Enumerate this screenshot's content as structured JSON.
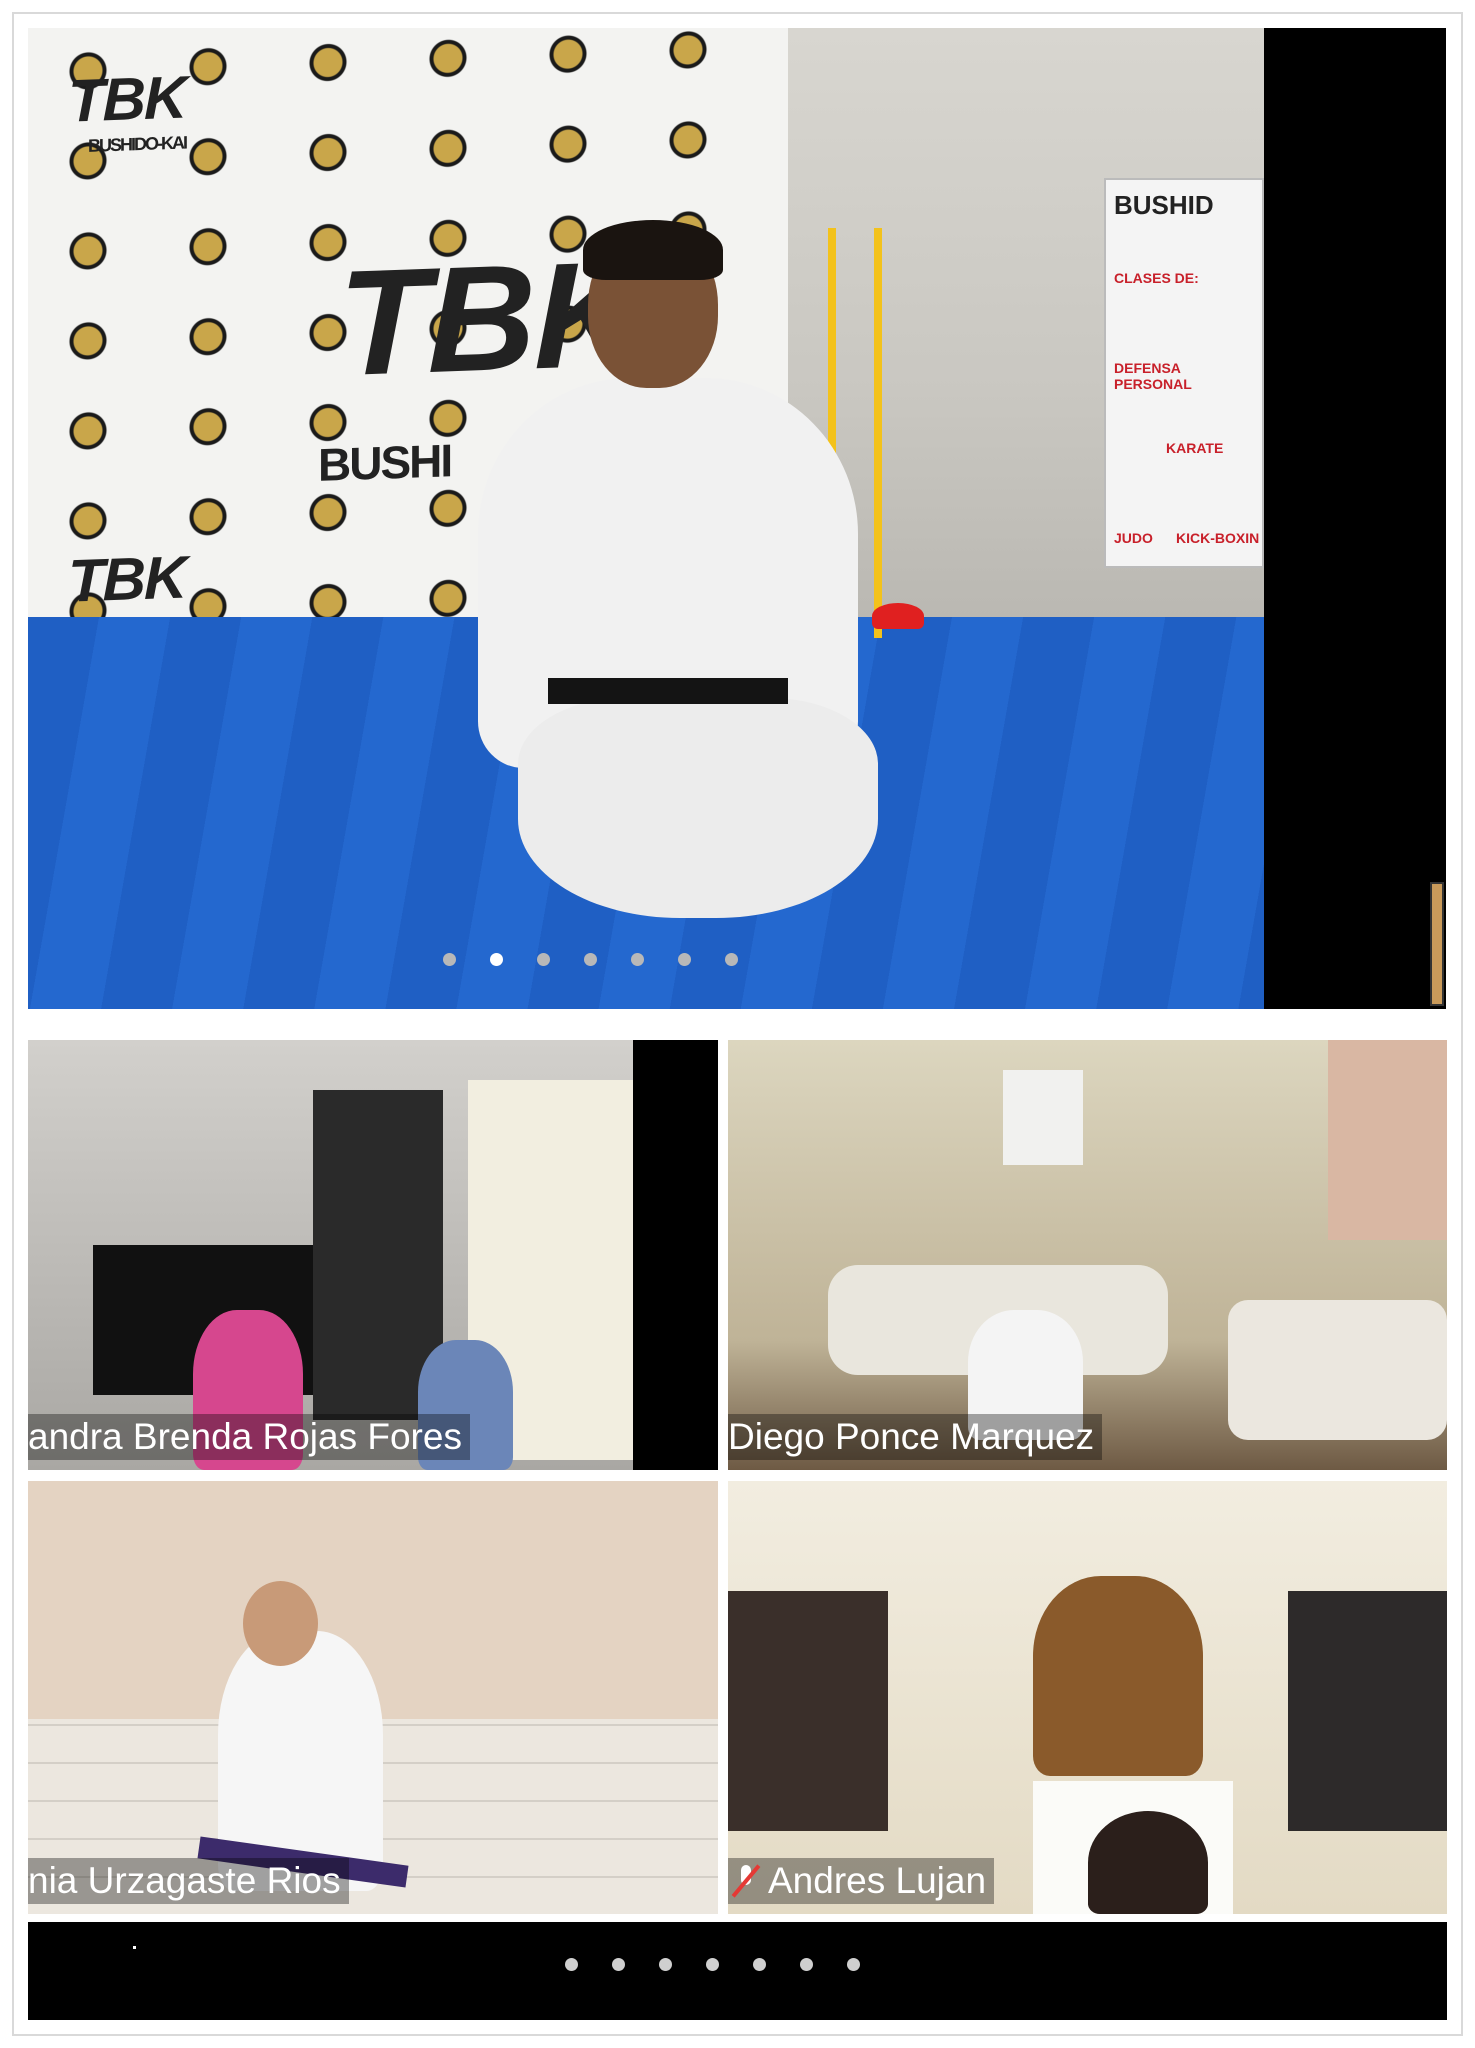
{
  "main_video": {
    "banner_brand": "TBK",
    "banner_sub": "BUSHIDO-KAI",
    "banner_big": "BUSHI",
    "poster_title": "BUSHID",
    "poster_lines": [
      "CLASES DE:",
      "DEFENSA PERSONAL",
      "KARATE",
      "JUDO",
      "KICK-BOXIN"
    ],
    "page_dots": {
      "count": 7,
      "active_index": 1
    }
  },
  "participants": [
    {
      "name": "andra Brenda Rojas Fores",
      "muted": false
    },
    {
      "name": "Diego Ponce Marquez",
      "muted": false
    },
    {
      "name": "nia Urzagaste Rios",
      "muted": false
    },
    {
      "name": "Andres Lujan",
      "muted": true
    }
  ],
  "gallery_dots": {
    "count": 7,
    "active_index": 3
  },
  "colors": {
    "mat_blue": "#1f5fc4",
    "muted_red": "#e53935",
    "name_text": "#ffffff"
  }
}
